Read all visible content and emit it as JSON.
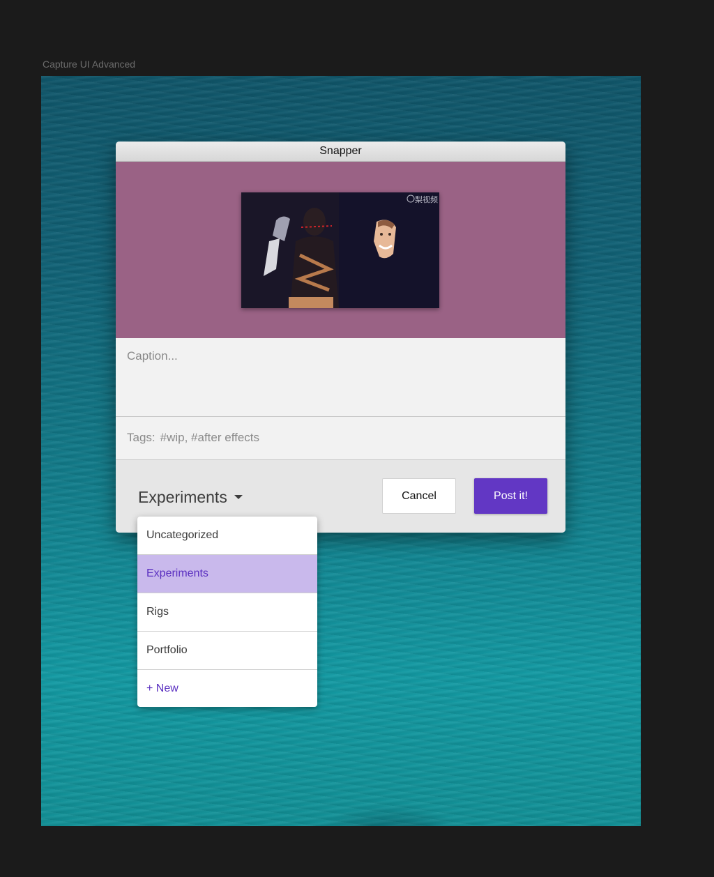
{
  "frame_label": "Capture UI Advanced",
  "window": {
    "title": "Snapper",
    "preview": {
      "watermark": "梨视频",
      "background_color": "#9a6285"
    },
    "caption_placeholder": "Caption...",
    "tags": {
      "label": "Tags:",
      "placeholder": "#wip, #after effects"
    },
    "footer": {
      "selected_category": "Experiments",
      "cancel_label": "Cancel",
      "post_label": "Post it!",
      "accent_color": "#6237c4"
    }
  },
  "dropdown": {
    "items": [
      {
        "label": "Uncategorized",
        "selected": false
      },
      {
        "label": "Experiments",
        "selected": true
      },
      {
        "label": "Rigs",
        "selected": false
      },
      {
        "label": "Portfolio",
        "selected": false
      },
      {
        "label": "+ New",
        "selected": false
      }
    ],
    "selected_color": "#c9b9ec"
  }
}
